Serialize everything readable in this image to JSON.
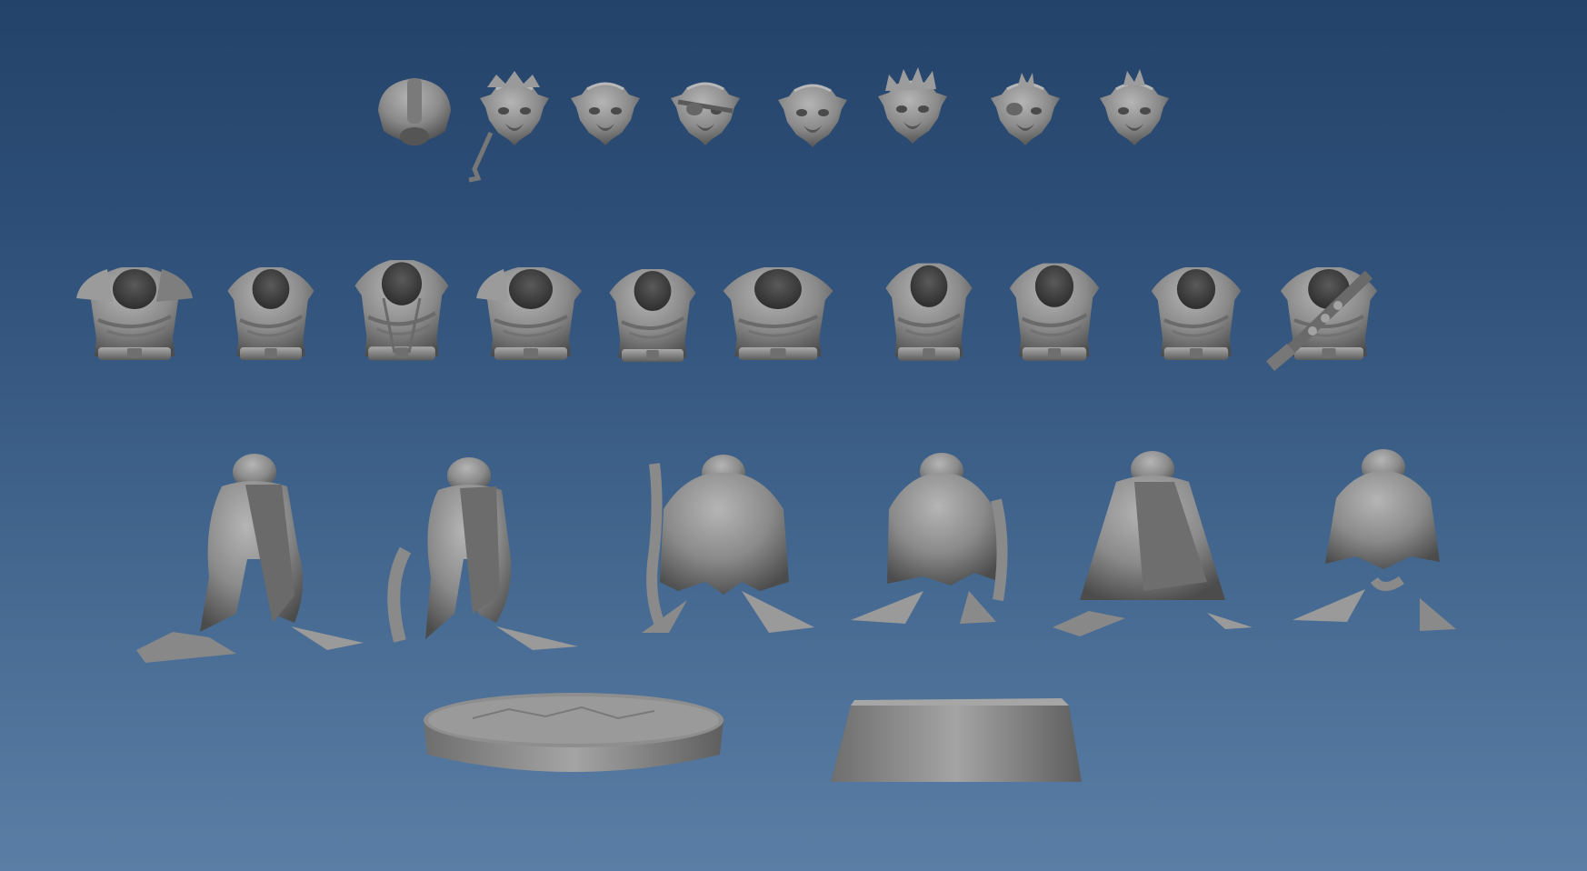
{
  "scene": {
    "background": {
      "top": "#24436a",
      "bottom": "#5a7ea5"
    },
    "model_color": "#8c8c8c",
    "model_shadow": "#4f4f4f",
    "model_highlight": "#b3b3b3"
  },
  "rows": [
    {
      "name": "heads",
      "count": 8
    },
    {
      "name": "torsos",
      "count": 10
    },
    {
      "name": "legs",
      "count": 6
    },
    {
      "name": "bases",
      "count": 2
    }
  ]
}
